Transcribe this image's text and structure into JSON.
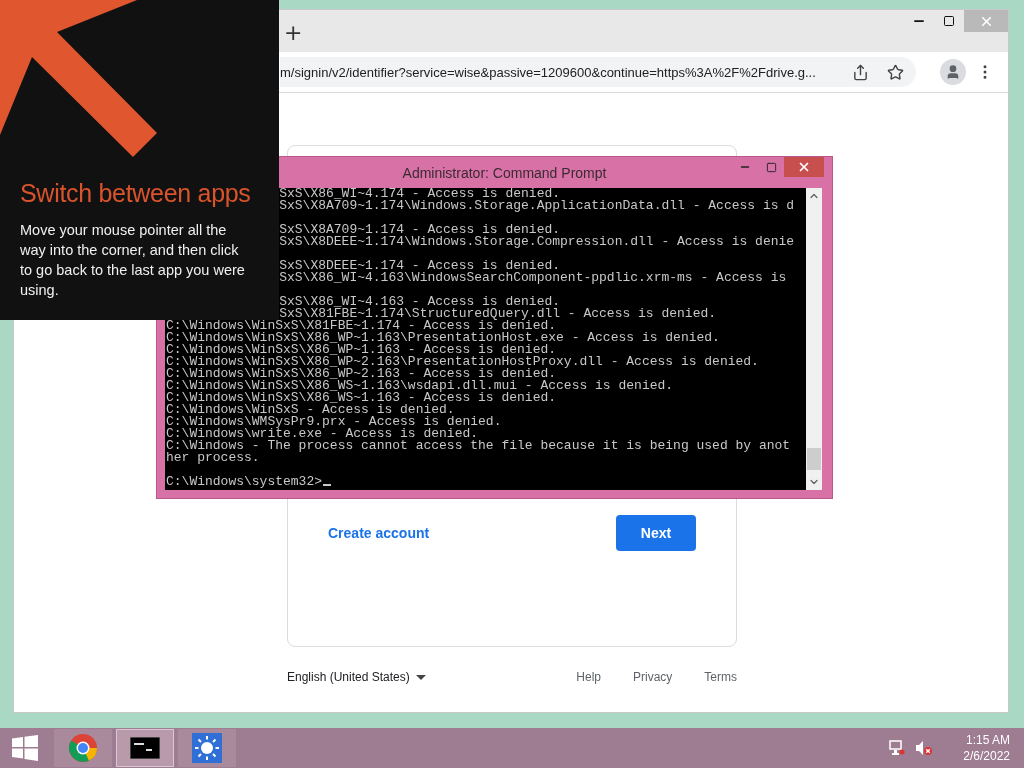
{
  "overlay": {
    "title": "Switch between apps",
    "body": "Move your mouse pointer all the way into the corner, and then click to go back to the last app you were using."
  },
  "browser": {
    "new_tab": "+",
    "url": "m/signin/v2/identifier?service=wise&passive=1209600&continue=https%3A%2F%2Fdrive.g...",
    "card": {
      "create_account": "Create account",
      "next": "Next"
    },
    "footer": {
      "language": "English (United States)",
      "links": [
        "Help",
        "Privacy",
        "Terms"
      ]
    }
  },
  "console": {
    "title": "Administrator: Command Prompt",
    "blocks": [
      [
        {
          "kind": "partial",
          "text": "SxS\\X86_WI~4.174 - Access is denied."
        },
        {
          "kind": "partial",
          "text": "SxS\\X8A709~1.174\\Windows.Storage.ApplicationData.dll - Access is d"
        }
      ],
      [
        {
          "kind": "partial",
          "text": "SxS\\X8A709~1.174 - Access is denied."
        },
        {
          "kind": "partial",
          "text": "SxS\\X8DEEE~1.174\\Windows.Storage.Compression.dll - Access is denie"
        }
      ],
      [
        {
          "kind": "partial",
          "text": "SxS\\X8DEEE~1.174 - Access is denied."
        },
        {
          "kind": "partial",
          "text": "SxS\\X86_WI~4.163\\WindowsSearchComponent-ppdlic.xrm-ms - Access is"
        }
      ],
      [
        {
          "kind": "partial",
          "text": "SxS\\X86_WI~4.163 - Access is denied."
        },
        {
          "kind": "partial",
          "text": "SxS\\X81FBE~1.174\\StructuredQuery.dll - Access is denied."
        },
        {
          "kind": "full",
          "text": "C:\\Windows\\WinSxS\\X81FBE~1.174 - Access is denied."
        },
        {
          "kind": "full",
          "text": "C:\\Windows\\WinSxS\\X86_WP~1.163\\PresentationHost.exe - Access is denied."
        },
        {
          "kind": "full",
          "text": "C:\\Windows\\WinSxS\\X86_WP~1.163 - Access is denied."
        },
        {
          "kind": "full",
          "text": "C:\\Windows\\WinSxS\\X86_WP~2.163\\PresentationHostProxy.dll - Access is denied."
        },
        {
          "kind": "full",
          "text": "C:\\Windows\\WinSxS\\X86_WP~2.163 - Access is denied."
        },
        {
          "kind": "full",
          "text": "C:\\Windows\\WinSxS\\X86_WS~1.163\\wsdapi.dll.mui - Access is denied."
        },
        {
          "kind": "full",
          "text": "C:\\Windows\\WinSxS\\X86_WS~1.163 - Access is denied."
        },
        {
          "kind": "full",
          "text": "C:\\Windows\\WinSxS - Access is denied."
        },
        {
          "kind": "full",
          "text": "C:\\Windows\\WMSysPr9.prx - Access is denied."
        },
        {
          "kind": "full",
          "text": "C:\\Windows\\write.exe - Access is denied."
        },
        {
          "kind": "full",
          "text": "C:\\Windows - The process cannot access the file because it is being used by anot"
        },
        {
          "kind": "full",
          "text": "her process."
        }
      ]
    ],
    "prompt": "C:\\Windows\\system32>"
  },
  "taskbar": {
    "apps": [
      {
        "kind": "browser",
        "selected": false
      },
      {
        "kind": "terminal",
        "selected": true
      },
      {
        "kind": "sun",
        "selected": false
      }
    ],
    "time": "1:15 AM",
    "date": "2/6/2022"
  }
}
